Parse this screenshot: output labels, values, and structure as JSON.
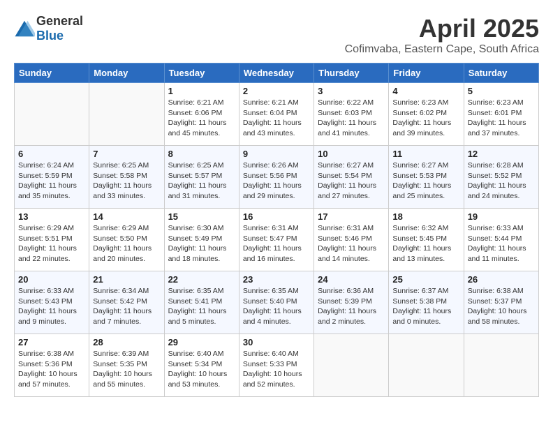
{
  "logo": {
    "general": "General",
    "blue": "Blue"
  },
  "title": "April 2025",
  "location": "Cofimvaba, Eastern Cape, South Africa",
  "days_of_week": [
    "Sunday",
    "Monday",
    "Tuesday",
    "Wednesday",
    "Thursday",
    "Friday",
    "Saturday"
  ],
  "weeks": [
    [
      {
        "day": "",
        "detail": ""
      },
      {
        "day": "",
        "detail": ""
      },
      {
        "day": "1",
        "detail": "Sunrise: 6:21 AM\nSunset: 6:06 PM\nDaylight: 11 hours and 45 minutes."
      },
      {
        "day": "2",
        "detail": "Sunrise: 6:21 AM\nSunset: 6:04 PM\nDaylight: 11 hours and 43 minutes."
      },
      {
        "day": "3",
        "detail": "Sunrise: 6:22 AM\nSunset: 6:03 PM\nDaylight: 11 hours and 41 minutes."
      },
      {
        "day": "4",
        "detail": "Sunrise: 6:23 AM\nSunset: 6:02 PM\nDaylight: 11 hours and 39 minutes."
      },
      {
        "day": "5",
        "detail": "Sunrise: 6:23 AM\nSunset: 6:01 PM\nDaylight: 11 hours and 37 minutes."
      }
    ],
    [
      {
        "day": "6",
        "detail": "Sunrise: 6:24 AM\nSunset: 5:59 PM\nDaylight: 11 hours and 35 minutes."
      },
      {
        "day": "7",
        "detail": "Sunrise: 6:25 AM\nSunset: 5:58 PM\nDaylight: 11 hours and 33 minutes."
      },
      {
        "day": "8",
        "detail": "Sunrise: 6:25 AM\nSunset: 5:57 PM\nDaylight: 11 hours and 31 minutes."
      },
      {
        "day": "9",
        "detail": "Sunrise: 6:26 AM\nSunset: 5:56 PM\nDaylight: 11 hours and 29 minutes."
      },
      {
        "day": "10",
        "detail": "Sunrise: 6:27 AM\nSunset: 5:54 PM\nDaylight: 11 hours and 27 minutes."
      },
      {
        "day": "11",
        "detail": "Sunrise: 6:27 AM\nSunset: 5:53 PM\nDaylight: 11 hours and 25 minutes."
      },
      {
        "day": "12",
        "detail": "Sunrise: 6:28 AM\nSunset: 5:52 PM\nDaylight: 11 hours and 24 minutes."
      }
    ],
    [
      {
        "day": "13",
        "detail": "Sunrise: 6:29 AM\nSunset: 5:51 PM\nDaylight: 11 hours and 22 minutes."
      },
      {
        "day": "14",
        "detail": "Sunrise: 6:29 AM\nSunset: 5:50 PM\nDaylight: 11 hours and 20 minutes."
      },
      {
        "day": "15",
        "detail": "Sunrise: 6:30 AM\nSunset: 5:49 PM\nDaylight: 11 hours and 18 minutes."
      },
      {
        "day": "16",
        "detail": "Sunrise: 6:31 AM\nSunset: 5:47 PM\nDaylight: 11 hours and 16 minutes."
      },
      {
        "day": "17",
        "detail": "Sunrise: 6:31 AM\nSunset: 5:46 PM\nDaylight: 11 hours and 14 minutes."
      },
      {
        "day": "18",
        "detail": "Sunrise: 6:32 AM\nSunset: 5:45 PM\nDaylight: 11 hours and 13 minutes."
      },
      {
        "day": "19",
        "detail": "Sunrise: 6:33 AM\nSunset: 5:44 PM\nDaylight: 11 hours and 11 minutes."
      }
    ],
    [
      {
        "day": "20",
        "detail": "Sunrise: 6:33 AM\nSunset: 5:43 PM\nDaylight: 11 hours and 9 minutes."
      },
      {
        "day": "21",
        "detail": "Sunrise: 6:34 AM\nSunset: 5:42 PM\nDaylight: 11 hours and 7 minutes."
      },
      {
        "day": "22",
        "detail": "Sunrise: 6:35 AM\nSunset: 5:41 PM\nDaylight: 11 hours and 5 minutes."
      },
      {
        "day": "23",
        "detail": "Sunrise: 6:35 AM\nSunset: 5:40 PM\nDaylight: 11 hours and 4 minutes."
      },
      {
        "day": "24",
        "detail": "Sunrise: 6:36 AM\nSunset: 5:39 PM\nDaylight: 11 hours and 2 minutes."
      },
      {
        "day": "25",
        "detail": "Sunrise: 6:37 AM\nSunset: 5:38 PM\nDaylight: 11 hours and 0 minutes."
      },
      {
        "day": "26",
        "detail": "Sunrise: 6:38 AM\nSunset: 5:37 PM\nDaylight: 10 hours and 58 minutes."
      }
    ],
    [
      {
        "day": "27",
        "detail": "Sunrise: 6:38 AM\nSunset: 5:36 PM\nDaylight: 10 hours and 57 minutes."
      },
      {
        "day": "28",
        "detail": "Sunrise: 6:39 AM\nSunset: 5:35 PM\nDaylight: 10 hours and 55 minutes."
      },
      {
        "day": "29",
        "detail": "Sunrise: 6:40 AM\nSunset: 5:34 PM\nDaylight: 10 hours and 53 minutes."
      },
      {
        "day": "30",
        "detail": "Sunrise: 6:40 AM\nSunset: 5:33 PM\nDaylight: 10 hours and 52 minutes."
      },
      {
        "day": "",
        "detail": ""
      },
      {
        "day": "",
        "detail": ""
      },
      {
        "day": "",
        "detail": ""
      }
    ]
  ]
}
